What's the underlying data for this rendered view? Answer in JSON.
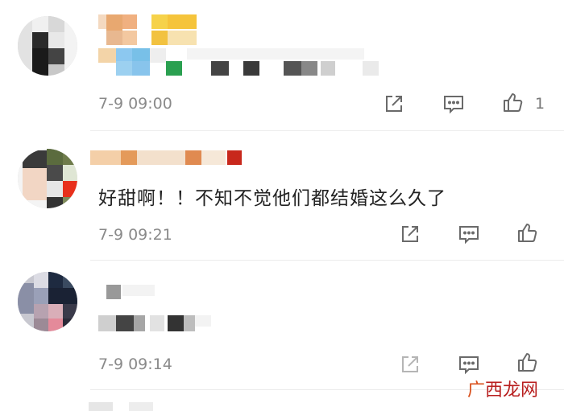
{
  "comments": [
    {
      "name": "",
      "text": "",
      "time": "7-9 09:00",
      "like_count": "1"
    },
    {
      "name": "",
      "text": "好甜啊！！不知不觉他们都结婚这么久了",
      "time": "7-9 09:21",
      "like_count": ""
    },
    {
      "name": "",
      "text": "",
      "time": "7-9 09:14",
      "like_count": ""
    }
  ],
  "watermark": {
    "part1": "广",
    "part2": "西龙网"
  },
  "icons": {
    "share": "share-icon",
    "comment": "comment-icon",
    "like": "like-icon"
  },
  "colors": {
    "text": "#222222",
    "muted": "#8a8a8a",
    "watermark": "#b81e1e"
  }
}
